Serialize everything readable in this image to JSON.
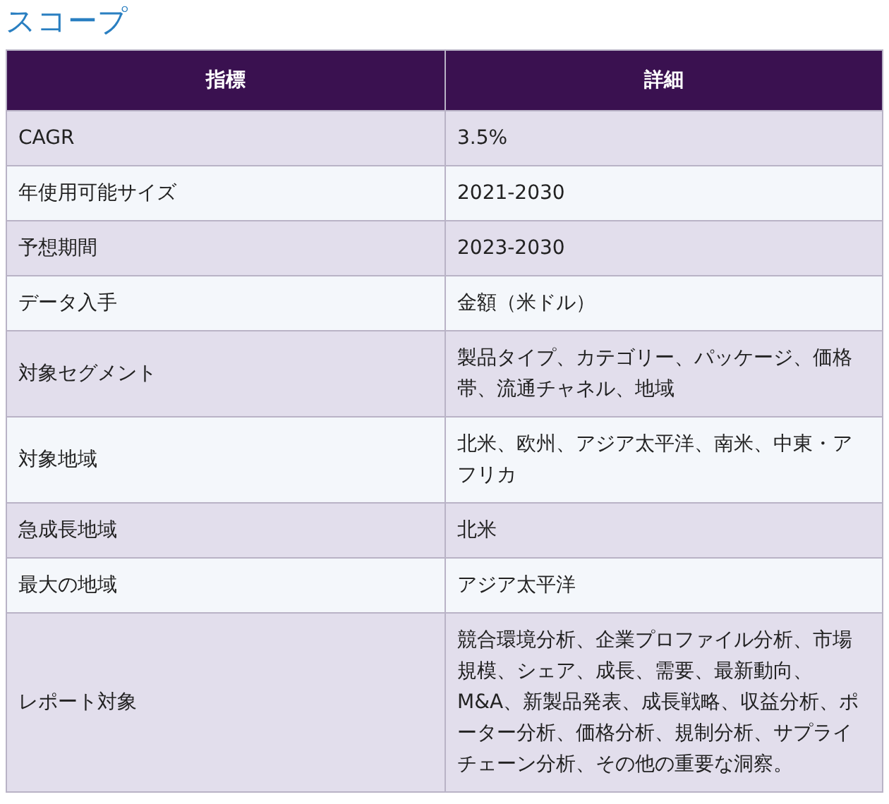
{
  "title": "スコープ",
  "table": {
    "columns": [
      "指標",
      "詳細"
    ],
    "rows": [
      [
        "CAGR",
        "3.5%"
      ],
      [
        "年使用可能サイズ",
        "2021-2030"
      ],
      [
        "予想期間",
        "2023-2030"
      ],
      [
        "データ入手",
        "金額（米ドル）"
      ],
      [
        "対象セグメント",
        "製品タイプ、カテゴリー、パッケージ、価格帯、流通チャネル、地域"
      ],
      [
        "対象地域",
        "北米、欧州、アジア太平洋、南米、中東・アフリカ"
      ],
      [
        "急成長地域",
        "北米"
      ],
      [
        "最大の地域",
        "アジア太平洋"
      ],
      [
        "レポート対象",
        "競合環境分析、企業プロファイル分析、市場規模、シェア、成長、需要、最新動向、M&A、新製品発表、成長戦略、収益分析、ポーター分析、価格分析、規制分析、サプライチェーン分析、その他の重要な洞察。"
      ]
    ]
  }
}
